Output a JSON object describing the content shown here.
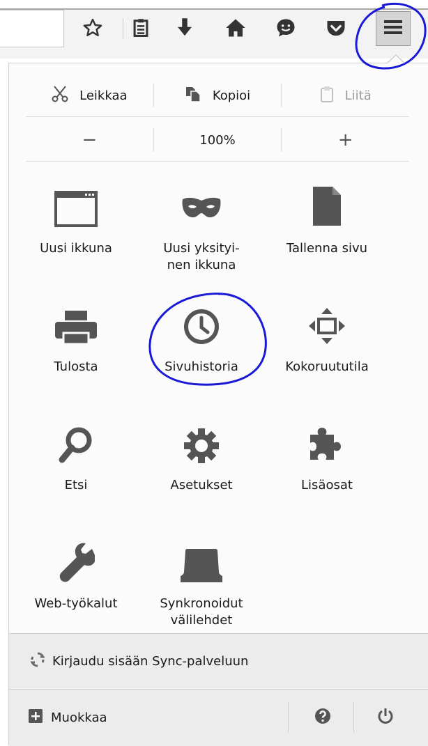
{
  "edit": {
    "cut": "Leikkaa",
    "copy": "Kopioi",
    "paste": "Liitä"
  },
  "zoom": {
    "minus": "−",
    "level": "100%",
    "plus": "+"
  },
  "grid": [
    {
      "label": "Uusi ikkuna",
      "icon": "new-window-icon"
    },
    {
      "label": "Uusi yksityi-\nnen ikkuna",
      "icon": "private-mask-icon"
    },
    {
      "label": "Tallenna sivu",
      "icon": "save-page-icon"
    },
    {
      "label": "Tulosta",
      "icon": "printer-icon"
    },
    {
      "label": "Sivuhistoria",
      "icon": "history-clock-icon"
    },
    {
      "label": "Kokoruututila",
      "icon": "fullscreen-icon"
    },
    {
      "label": "Etsi",
      "icon": "search-icon"
    },
    {
      "label": "Asetukset",
      "icon": "gear-icon"
    },
    {
      "label": "Lisäosat",
      "icon": "puzzle-icon"
    },
    {
      "label": "Web-työkalut",
      "icon": "wrench-icon"
    },
    {
      "label": "Synkronoidut\nvälilehdet",
      "icon": "synced-tabs-icon"
    }
  ],
  "footer": {
    "sync": "Kirjaudu sisään Sync-palveluun",
    "customize": "Muokkaa"
  },
  "toolbar_icons": [
    "star-icon",
    "reading-list-icon",
    "download-icon",
    "home-icon",
    "hello-icon",
    "pocket-icon",
    "hamburger-menu-icon"
  ],
  "annotation_color": "#1a1ad6"
}
